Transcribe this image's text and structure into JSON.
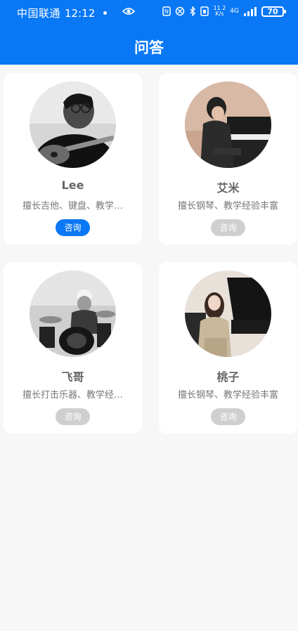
{
  "status_bar": {
    "carrier": "中国联通",
    "time": "12:12",
    "speed_value": "11.2",
    "speed_unit": "K/s",
    "network": "4G",
    "battery": "70"
  },
  "header": {
    "title": "问答"
  },
  "cards": [
    {
      "name": "Lee",
      "desc": "擅长吉他、键盘、教学…",
      "button": "咨询",
      "button_state": "active"
    },
    {
      "name": "艾米",
      "desc": "擅长钢琴、教学经验丰富",
      "button": "咨询",
      "button_state": "disabled"
    },
    {
      "name": "飞哥",
      "desc": "擅长打击乐器、教学经…",
      "button": "咨询",
      "button_state": "disabled"
    },
    {
      "name": "桃子",
      "desc": "擅长钢琴、教学经验丰富",
      "button": "咨询",
      "button_state": "disabled"
    }
  ],
  "colors": {
    "brand": "#0a78f5",
    "button_disabled": "#cfcfcf"
  },
  "icons": [
    "eye-icon",
    "nfc-icon",
    "bluetooth-icon",
    "vibrate-icon",
    "signal-icon",
    "battery-icon"
  ]
}
